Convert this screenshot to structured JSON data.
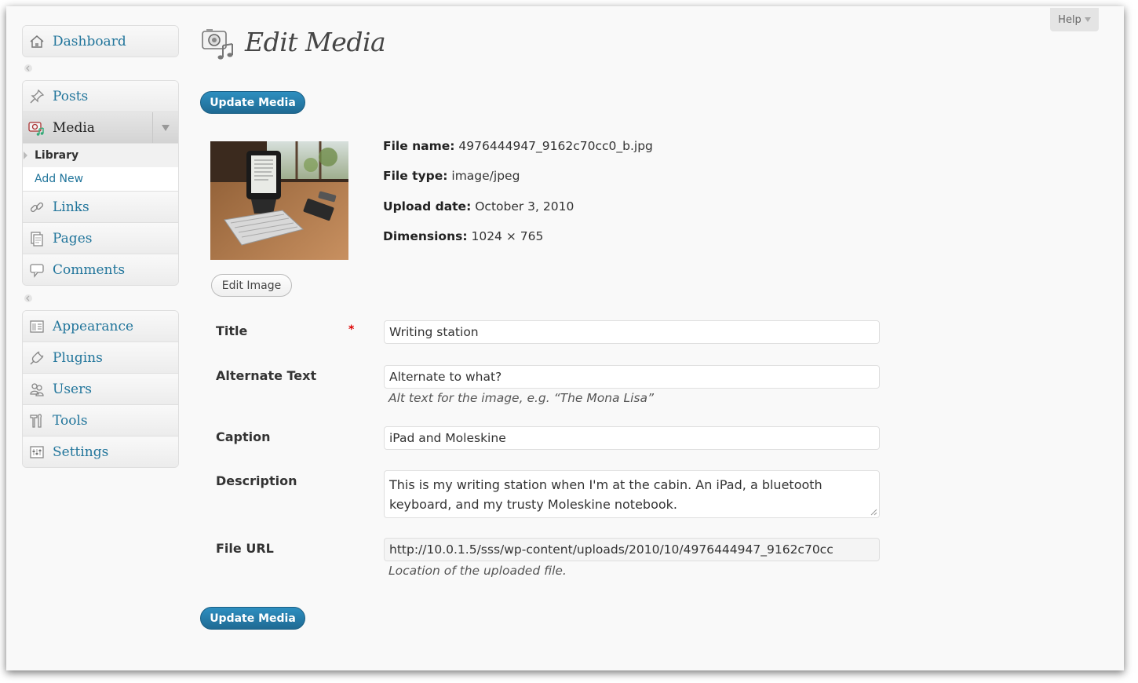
{
  "sidebar": {
    "dashboard": {
      "label": "Dashboard",
      "icon": "house-icon"
    },
    "posts": {
      "label": "Posts",
      "icon": "pushpin-icon"
    },
    "media": {
      "label": "Media",
      "icon": "camera-music-icon",
      "submenu": [
        {
          "label": "Library"
        },
        {
          "label": "Add New"
        }
      ]
    },
    "links": {
      "label": "Links",
      "icon": "chain-icon"
    },
    "pages": {
      "label": "Pages",
      "icon": "pages-icon"
    },
    "comments": {
      "label": "Comments",
      "icon": "speech-bubble-icon"
    },
    "appearance": {
      "label": "Appearance",
      "icon": "layout-icon"
    },
    "plugins": {
      "label": "Plugins",
      "icon": "plug-icon"
    },
    "users": {
      "label": "Users",
      "icon": "users-icon"
    },
    "tools": {
      "label": "Tools",
      "icon": "tools-icon"
    },
    "settings": {
      "label": "Settings",
      "icon": "settings-icon"
    }
  },
  "header": {
    "help_label": "Help",
    "title": "Edit Media"
  },
  "buttons": {
    "update_media": "Update Media",
    "edit_image": "Edit Image"
  },
  "file_info": {
    "file_name_label": "File name:",
    "file_name": "4976444947_9162c70cc0_b.jpg",
    "file_type_label": "File type:",
    "file_type": "image/jpeg",
    "upload_date_label": "Upload date:",
    "upload_date": "October 3, 2010",
    "dimensions_label": "Dimensions:",
    "dimensions": "1024 × 765"
  },
  "form": {
    "title": {
      "label": "Title",
      "required_mark": "*",
      "value": "Writing station"
    },
    "alt_text": {
      "label": "Alternate Text",
      "value": "Alternate to what?",
      "help": "Alt text for the image, e.g. “The Mona Lisa”"
    },
    "caption": {
      "label": "Caption",
      "value": "iPad and Moleskine"
    },
    "description": {
      "label": "Description",
      "value": "This is my writing station when I'm at the cabin. An iPad, a bluetooth keyboard, and my trusty Moleskine notebook."
    },
    "file_url": {
      "label": "File URL",
      "value": "http://10.0.1.5/sss/wp-content/uploads/2010/10/4976444947_9162c70cc",
      "help": "Location of the uploaded file."
    }
  },
  "colors": {
    "accent": "#21759b",
    "primary_button": "#2583b4",
    "required": "#dd0000"
  }
}
